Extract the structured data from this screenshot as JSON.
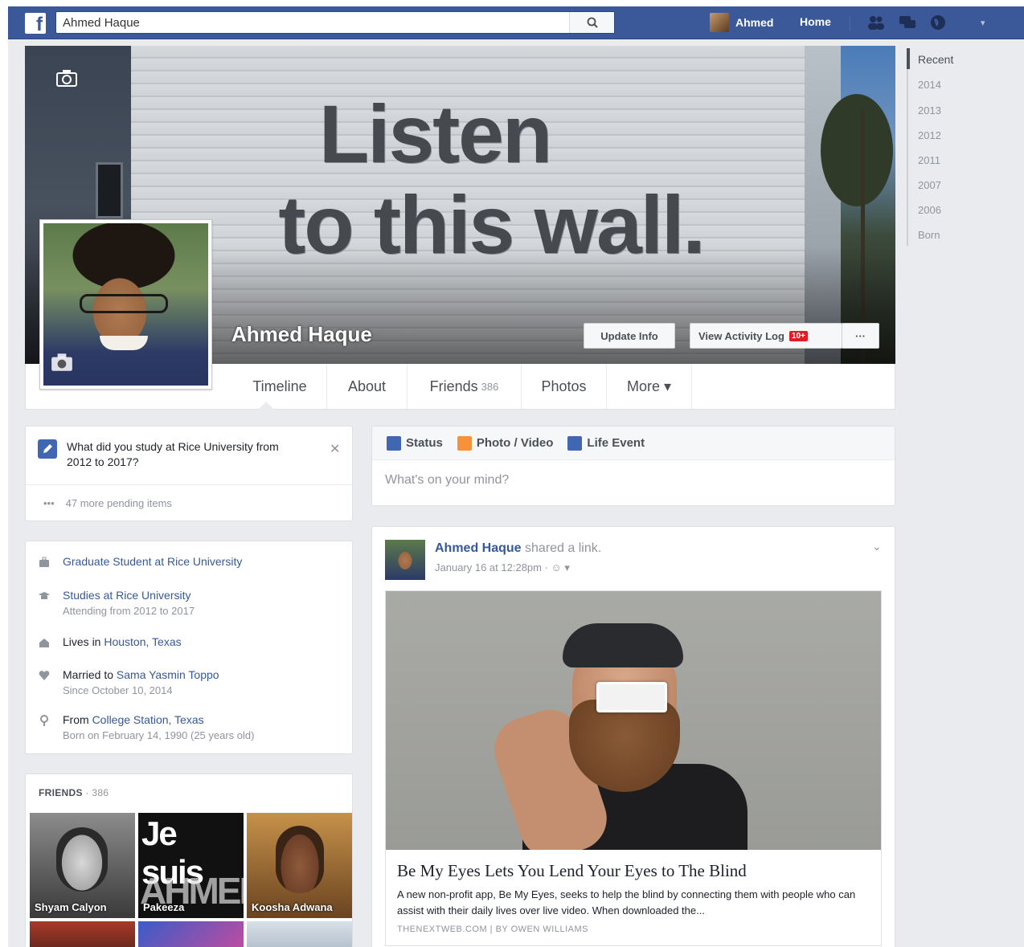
{
  "topbar": {
    "search_value": "Ahmed Haque",
    "user_name": "Ahmed",
    "home_label": "Home",
    "settings_label": "▾"
  },
  "cover": {
    "wall_line1": "Listen",
    "wall_line2": "to this wall.",
    "profile_name": "Ahmed Haque",
    "update_info_label": "Update Info",
    "activity_log_label": "View Activity Log",
    "activity_badge": "10+",
    "more_dots": "···"
  },
  "tabs": {
    "timeline": "Timeline",
    "about": "About",
    "friends": "Friends",
    "friends_count": "386",
    "photos": "Photos",
    "more": "More ▾"
  },
  "prompt": {
    "question": "What did you study at Rice University from 2012 to 2017?",
    "pending": "47 more pending items",
    "pending_dots": "•••"
  },
  "about": {
    "work": "Graduate Student at Rice University",
    "study_line1": "Studies at Rice University",
    "study_line2": "Attending from 2012 to 2017",
    "lives_prefix": "Lives in ",
    "lives_place": "Houston, Texas",
    "married_prefix": "Married to ",
    "married_name": "Sama Yasmin Toppo",
    "married_since": "Since October 10, 2014",
    "from_prefix": "From ",
    "from_place": "College Station, Texas",
    "born": "Born on February 14, 1990 (25 years old)"
  },
  "friends": {
    "heading": "FRIENDS",
    "count": " · 386",
    "names": [
      "Shyam Calyon",
      "Pakeeza",
      "Koosha Adwana"
    ],
    "je_suis_line1": "Je suis",
    "je_suis_line2": "AHMED"
  },
  "composer": {
    "status": "Status",
    "photo_video": "Photo / Video",
    "life_event": "Life Event",
    "placeholder": "What's on your mind?"
  },
  "post": {
    "author": "Ahmed Haque",
    "action": " shared a link.",
    "meta": "January 16 at 12:28pm · ☺ ▾",
    "link_title": "Be My Eyes Lets You Lend Your Eyes to The Blind",
    "link_desc": "A new non-profit app, Be My Eyes, seeks to help the blind by connecting them with people who can assist with their daily lives over live video. When downloaded the...",
    "link_source": "THENEXTWEB.COM | BY OWEN WILLIAMS"
  },
  "years": [
    "Recent",
    "2014",
    "2013",
    "2012",
    "2011",
    "2007",
    "2006",
    "Born"
  ]
}
